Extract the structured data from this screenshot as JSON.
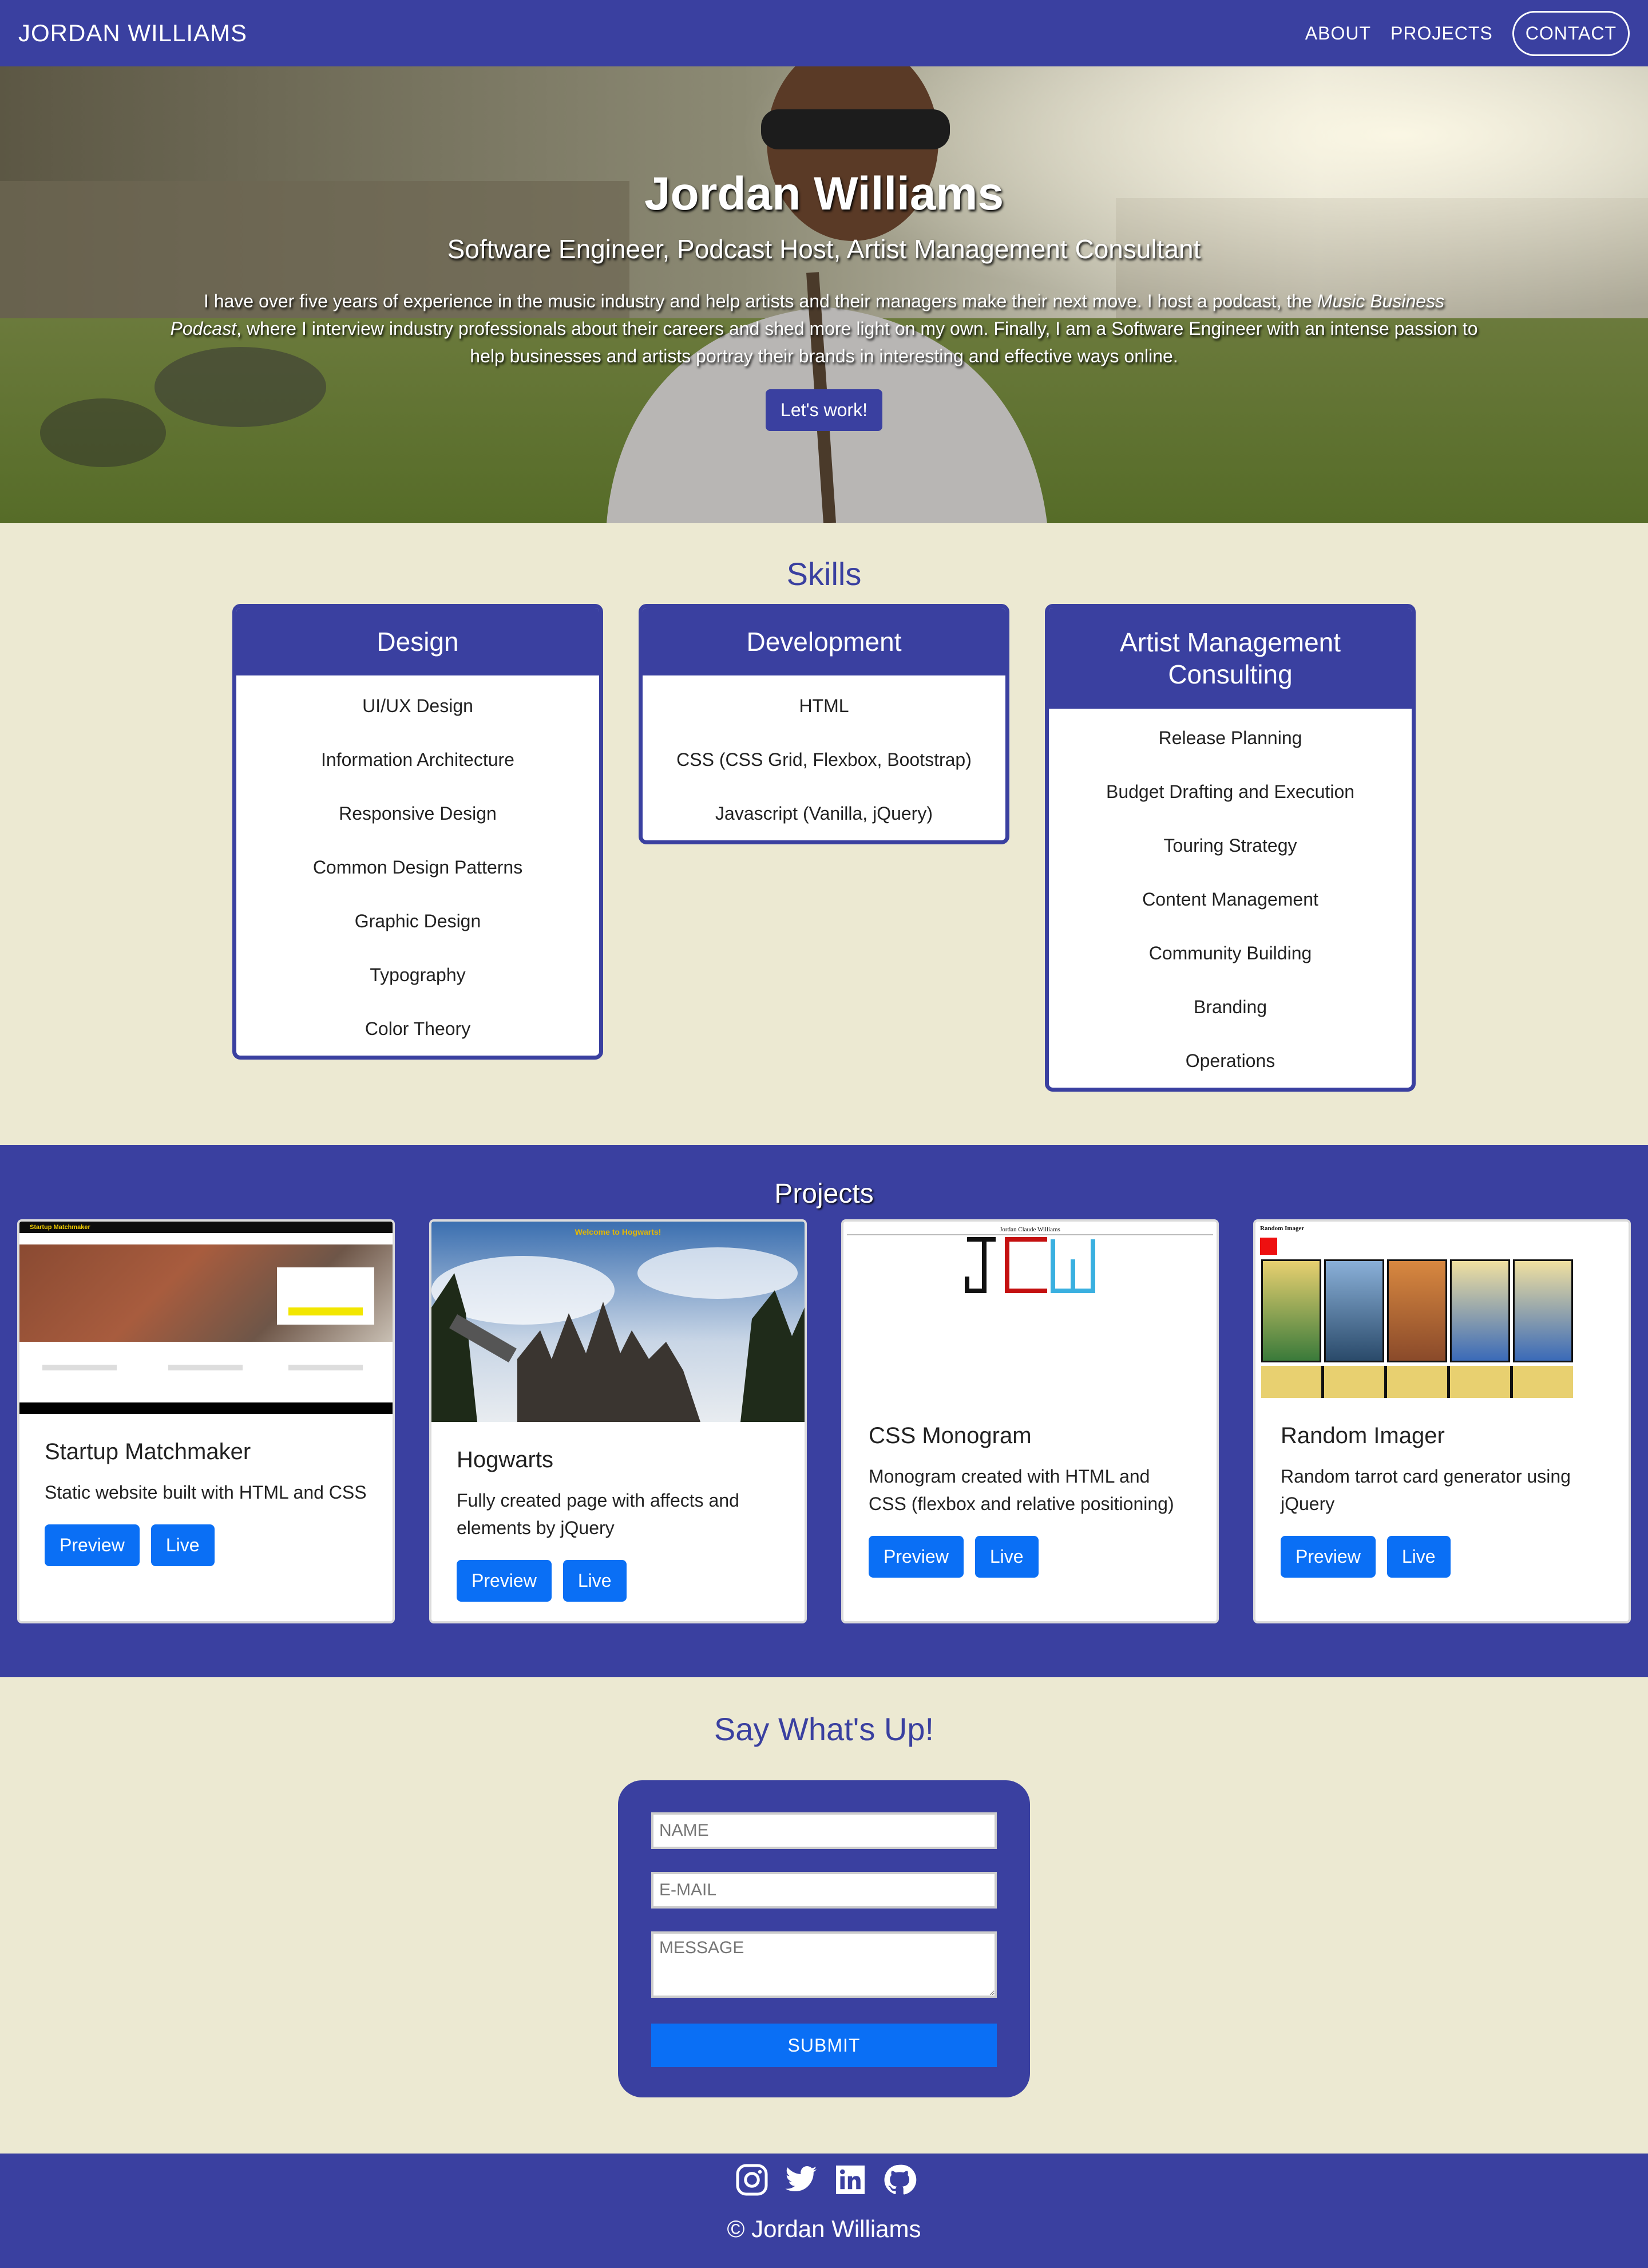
{
  "nav": {
    "brand": "JORDAN WILLIAMS",
    "links": [
      "ABOUT",
      "PROJECTS",
      "CONTACT"
    ]
  },
  "hero": {
    "title": "Jordan Williams",
    "subtitle": "Software Engineer, Podcast Host, Artist Management Consultant",
    "text_part1": "I have over five years of experience in the music industry and help artists and their managers make their next move. I host a podcast, the ",
    "text_italic": "Music Business Podcast",
    "text_part2": ", where I interview industry professionals about their careers and shed more light on my own. Finally, I am a Software Engineer with an intense passion to help businesses and artists portray their brands in interesting and effective ways online.",
    "button": "Let's work!"
  },
  "skills": {
    "title": "Skills",
    "cards": [
      {
        "title": "Design",
        "items": [
          "UI/UX Design",
          "Information Architecture",
          "Responsive Design",
          "Common Design Patterns",
          "Graphic Design",
          "Typography",
          "Color Theory"
        ]
      },
      {
        "title": "Development",
        "items": [
          "HTML",
          "CSS (CSS Grid, Flexbox, Bootstrap)",
          "Javascript (Vanilla, jQuery)"
        ]
      },
      {
        "title": "Artist Management Consulting",
        "items": [
          "Release Planning",
          "Budget Drafting and Execution",
          "Touring Strategy",
          "Content Management",
          "Community Building",
          "Branding",
          "Operations"
        ]
      }
    ]
  },
  "projects": {
    "title": "Projects",
    "cards": [
      {
        "title": "Startup Matchmaker",
        "desc": "Static website built with HTML and CSS",
        "preview": "Preview",
        "live": "Live",
        "thumb_label": "Startup Matchmaker"
      },
      {
        "title": "Hogwarts",
        "desc": "Fully created page with affects and elements by jQuery",
        "preview": "Preview",
        "live": "Live",
        "thumb_label": "Welcome to Hogwarts!"
      },
      {
        "title": "CSS Monogram",
        "desc": "Monogram created with HTML and CSS (flexbox and relative positioning)",
        "preview": "Preview",
        "live": "Live",
        "thumb_label": "Jordan Claude Williams"
      },
      {
        "title": "Random Imager",
        "desc": "Random tarrot card generator using jQuery",
        "preview": "Preview",
        "live": "Live",
        "thumb_label": "Random Imager"
      }
    ]
  },
  "contact": {
    "title": "Say What's Up!",
    "name_placeholder": "NAME",
    "email_placeholder": "E-MAIL",
    "message_placeholder": "MESSAGE",
    "submit": "SUBMIT"
  },
  "footer": {
    "icons": [
      "instagram-icon",
      "twitter-icon",
      "linkedin-icon",
      "github-icon"
    ],
    "copyright": "© Jordan Williams"
  },
  "colors": {
    "primary": "#3a40a0",
    "background": "#ece9d2",
    "button_blue": "#0a6ff5"
  }
}
